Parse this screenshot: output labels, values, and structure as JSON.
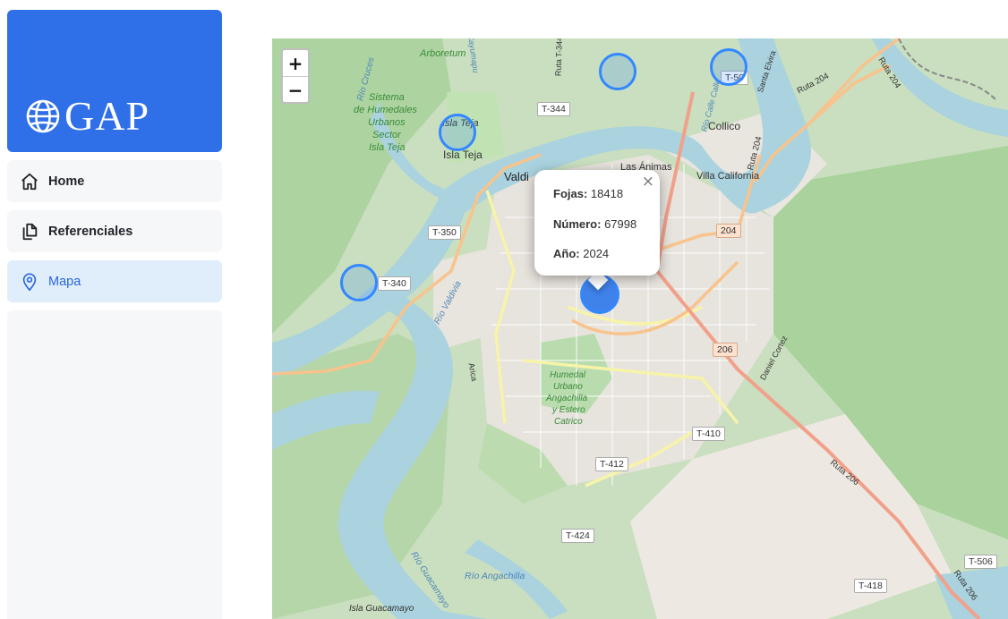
{
  "brand": {
    "title": "GAP",
    "icon": "globe-icon",
    "color": "#2f6fe8"
  },
  "nav": [
    {
      "label": "Home",
      "icon": "home-icon",
      "active": false
    },
    {
      "label": "Referenciales",
      "icon": "documents-icon",
      "active": false
    },
    {
      "label": "Mapa",
      "icon": "map-pin-icon",
      "active": true
    }
  ],
  "map": {
    "zoom_in": "+",
    "zoom_out": "−",
    "popup": {
      "fojas_label": "Fojas:",
      "fojas_value": "18418",
      "numero_label": "Número:",
      "numero_value": "67998",
      "anio_label": "Año:",
      "anio_value": "2024",
      "close": "×"
    },
    "labels": {
      "arboretum": "Arboretum",
      "sistema": "Sistema",
      "humedales": "de Humedales",
      "urbanos": "Urbanos",
      "sector": "Sector",
      "isla_teja_green": "Isla Teja",
      "isla_teja_italic": "Isla Teja",
      "isla_teja": "Isla Teja",
      "valdivia": "Valdi",
      "las_animas": "Las Ánimas",
      "collico": "Collico",
      "villa_california": "Villa California",
      "humedal": "Humedal",
      "urbano": "Urbano",
      "angachilla": "Angachilla",
      "y_estero": "y Estero",
      "catrico": "Catrico",
      "rio_valdivia": "Río Valdivia",
      "rio_cruces": "Río Cruces",
      "rio_guacamayo": "Río Guacamayo",
      "rio_angachilla": "Río Angachilla",
      "isla_guacamayo": "Isla Guacamayo",
      "ruta_204": "Ruta 204",
      "ruta_204b": "Ruta 204",
      "ruta_206": "Ruta 206",
      "ruta_206b": "Ruta 206",
      "santa_elvira": "Santa Elvira",
      "daniel_cortez": "Daniel Cortez",
      "ruta_t344": "Ruta T-344",
      "arica": "Arica",
      "calle_calle": "Río Calle Calle",
      "cayumapu": "Cayumapu"
    },
    "shields": {
      "t344": "T-344",
      "t350": "T-350",
      "t340": "T-340",
      "t50": "T-50",
      "r204": "204",
      "r206": "206",
      "t410": "T-410",
      "t412": "T-412",
      "t424": "T-424",
      "t418": "T-418",
      "t506": "T-506"
    }
  }
}
